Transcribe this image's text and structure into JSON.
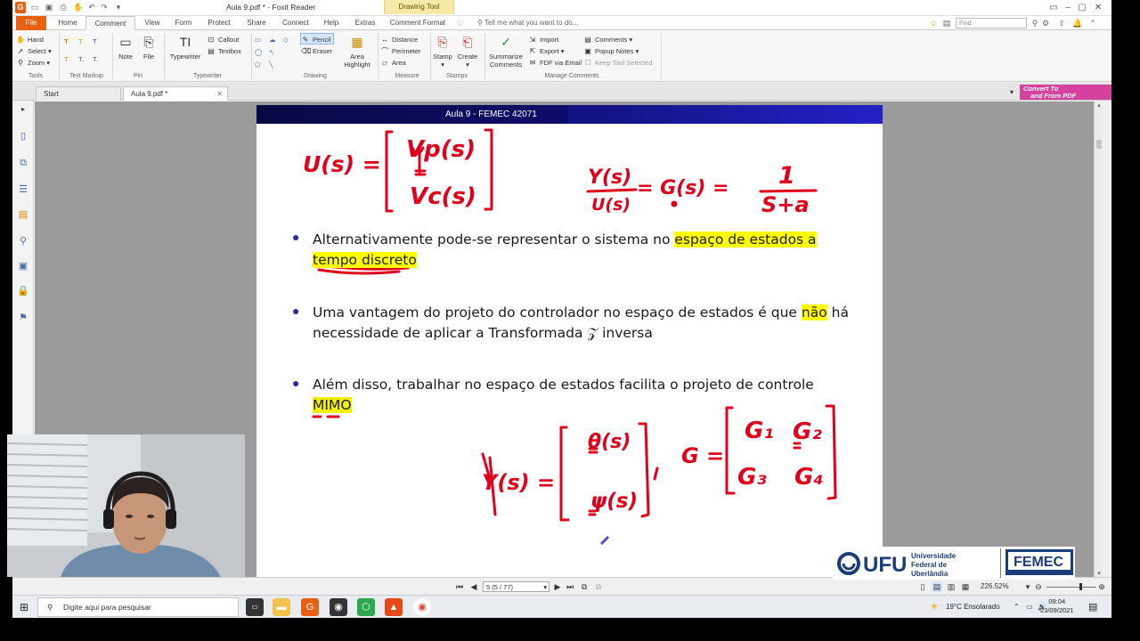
{
  "window": {
    "title": "Aula 9.pdf * - Foxit Reader",
    "context_tab": "Drawing Tool",
    "app_icon": "G"
  },
  "tabs": {
    "items": [
      "File",
      "Home",
      "Comment",
      "View",
      "Form",
      "Protect",
      "Share",
      "Connect",
      "Help",
      "Extras",
      "Comment Format"
    ],
    "active": "Comment",
    "tell_me": "Tell me what you want to do...",
    "find_placeholder": "Find"
  },
  "ribbon": {
    "tools": {
      "hand": "Hand",
      "select": "Select",
      "zoom": "Zoom",
      "label": "Tools"
    },
    "text_markup": {
      "label": "Text Markup"
    },
    "pin": {
      "note": "Note",
      "file": "File",
      "label": "Pin"
    },
    "typewriter": {
      "typewriter": "Typewriter",
      "callout": "Callout",
      "textbox": "Textbox",
      "label": "Typewriter"
    },
    "drawing": {
      "pencil": "Pencil",
      "eraser": "Eraser",
      "area_highlight": "Area Highlight",
      "label": "Drawing"
    },
    "measure": {
      "distance": "Distance",
      "perimeter": "Perimeter",
      "area": "Area",
      "label": "Measure"
    },
    "stamps": {
      "stamp": "Stamp",
      "create": "Create",
      "label": "Stamps"
    },
    "manage": {
      "summarize": "Summarize Comments",
      "import": "Import",
      "export": "Export",
      "fdf": "FDF via Email",
      "comments": "Comments",
      "popup_notes": "Popup Notes",
      "keep_tool": "Keep Tool Selected",
      "label": "Manage Comments"
    }
  },
  "doc_tabs": [
    "Start",
    "Aula 9.pdf *"
  ],
  "convert": {
    "line1": "Convert To",
    "line2": "and From PDF"
  },
  "slide": {
    "header": "Aula 9 - FEMEC 42071",
    "bullet1": {
      "plain": "Alternativamente pode-se representar o sistema no ",
      "highlight1": "espaço de estados a",
      "highlight2": "tempo discreto"
    },
    "bullet2": {
      "plain1": "Uma vantagem do projeto do controlador no espaço de estados é que ",
      "highlight": "não",
      "plain2": " há",
      "line2": "necessidade de aplicar a Transformada 𝒵 inversa"
    },
    "bullet3": {
      "plain": "Além disso, trabalhar no espaço de estados facilita o projeto de controle",
      "highlight": "MIMO"
    },
    "handwriting": {
      "u_of_s": "U(s) =",
      "vp": "Vp(s)",
      "vc": "Vc(s)",
      "y_over_u": "Y(s)",
      "u_den": "U(s)",
      "g_of_s": "= G(s) =",
      "one": "1",
      "s_plus_a": "S+a",
      "y_vec": "Y(s) =",
      "theta": "θ(s)",
      "psi": "ψ(s)",
      "g_eq": "G =",
      "g1": "G₁",
      "g2": "G₂",
      "g3": "G₃",
      "g4": "G₄"
    },
    "ink_color": "#e0001b"
  },
  "ufu_logo": {
    "name": "UFU",
    "full1": "Universidade",
    "full2": "Federal de",
    "full3": "Uberlândia",
    "femec": "FEMEC"
  },
  "navbar": {
    "page": "5 (5 / 77)",
    "zoom": "226.52%"
  },
  "taskbar": {
    "search": "Digite aqui para pesquisar",
    "weather": "19°C  Ensolarado",
    "time": "09:04",
    "date": "23/09/2021"
  },
  "colors": {
    "accent": "#e86012",
    "header_blue": "#131385",
    "highlight": "#ffff00",
    "pink": "#d6409e"
  }
}
